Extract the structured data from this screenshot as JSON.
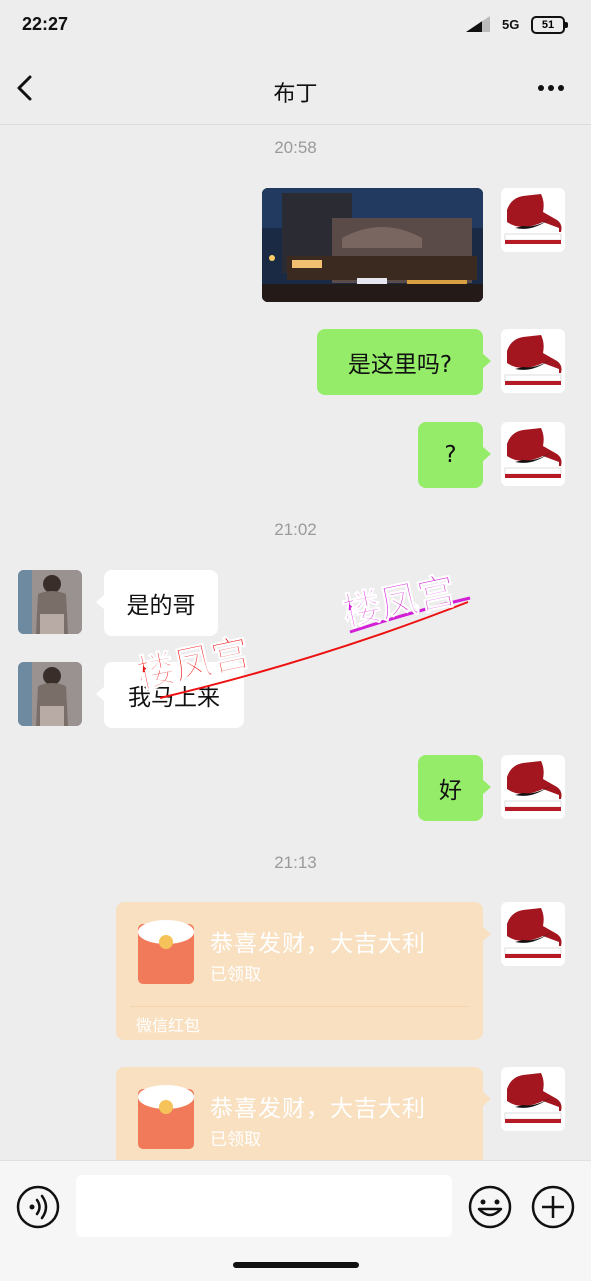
{
  "status_bar": {
    "time": "22:27",
    "network": "5G",
    "battery": "51"
  },
  "header": {
    "title": "布丁",
    "back_icon": "chevron-left-icon",
    "more_icon": "more-dots-icon"
  },
  "messages": {
    "timestamp_1": "20:58",
    "outgoing_photo": {
      "description_icon": "photo-thumbnail"
    },
    "outgoing_1": "是这里吗?",
    "outgoing_2": "?",
    "timestamp_2": "21:02",
    "incoming_1": "是的哥",
    "incoming_2": "我马上来",
    "outgoing_3": "好",
    "timestamp_3": "21:13",
    "red_packet_1": {
      "title": "恭喜发财，大吉大利",
      "status": "已领取",
      "footer": "微信红包"
    },
    "red_packet_2": {
      "title": "恭喜发财，大吉大利",
      "status": "已领取"
    }
  },
  "watermark": {
    "text_1": "楼凤宫",
    "text_2": "楼凤宫",
    "color_1": "#ff1a1a",
    "color_2": "#d21fd6"
  },
  "input_bar": {
    "placeholder": "",
    "voice_icon": "voice-icon",
    "emoji_icon": "emoji-icon",
    "plus_icon": "plus-icon"
  },
  "colors": {
    "bubble_out": "#95ec69",
    "bubble_in": "#ffffff",
    "red_packet": "#f8e0c1",
    "background": "#ededed"
  }
}
